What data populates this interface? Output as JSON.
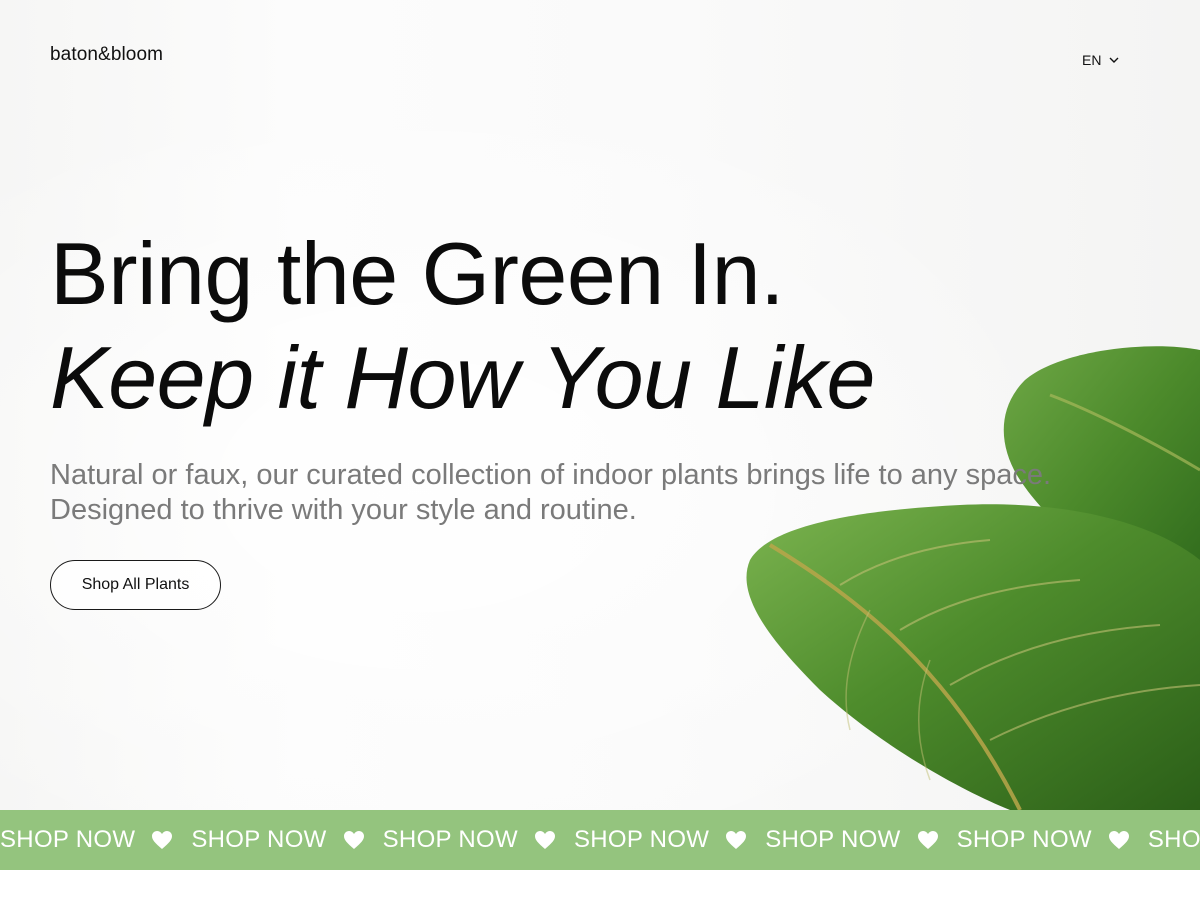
{
  "header": {
    "brand": "baton&bloom",
    "language": {
      "selected": "EN"
    }
  },
  "hero": {
    "headline_line1": "Bring the Green In.",
    "headline_line2": "Keep it How You Like",
    "subtext_line1": "Natural or faux, our curated collection of indoor plants brings life to any space.",
    "subtext_line2": "Designed to thrive with your style and routine.",
    "cta_label": "Shop All Plants"
  },
  "ticker": {
    "items": [
      "SHOP NOW",
      "SHOP NOW",
      "SHOP NOW",
      "SHOP NOW",
      "SHOP NOW",
      "SHOP NOW",
      "SHOP NOW"
    ],
    "separator_icon": "heart-icon",
    "background_color": "#94c47e",
    "text_color": "#ffffff"
  },
  "colors": {
    "leaf_green": "#4f8a2e",
    "headline": "#0b0b0b",
    "subtext": "#7a7a7a"
  }
}
